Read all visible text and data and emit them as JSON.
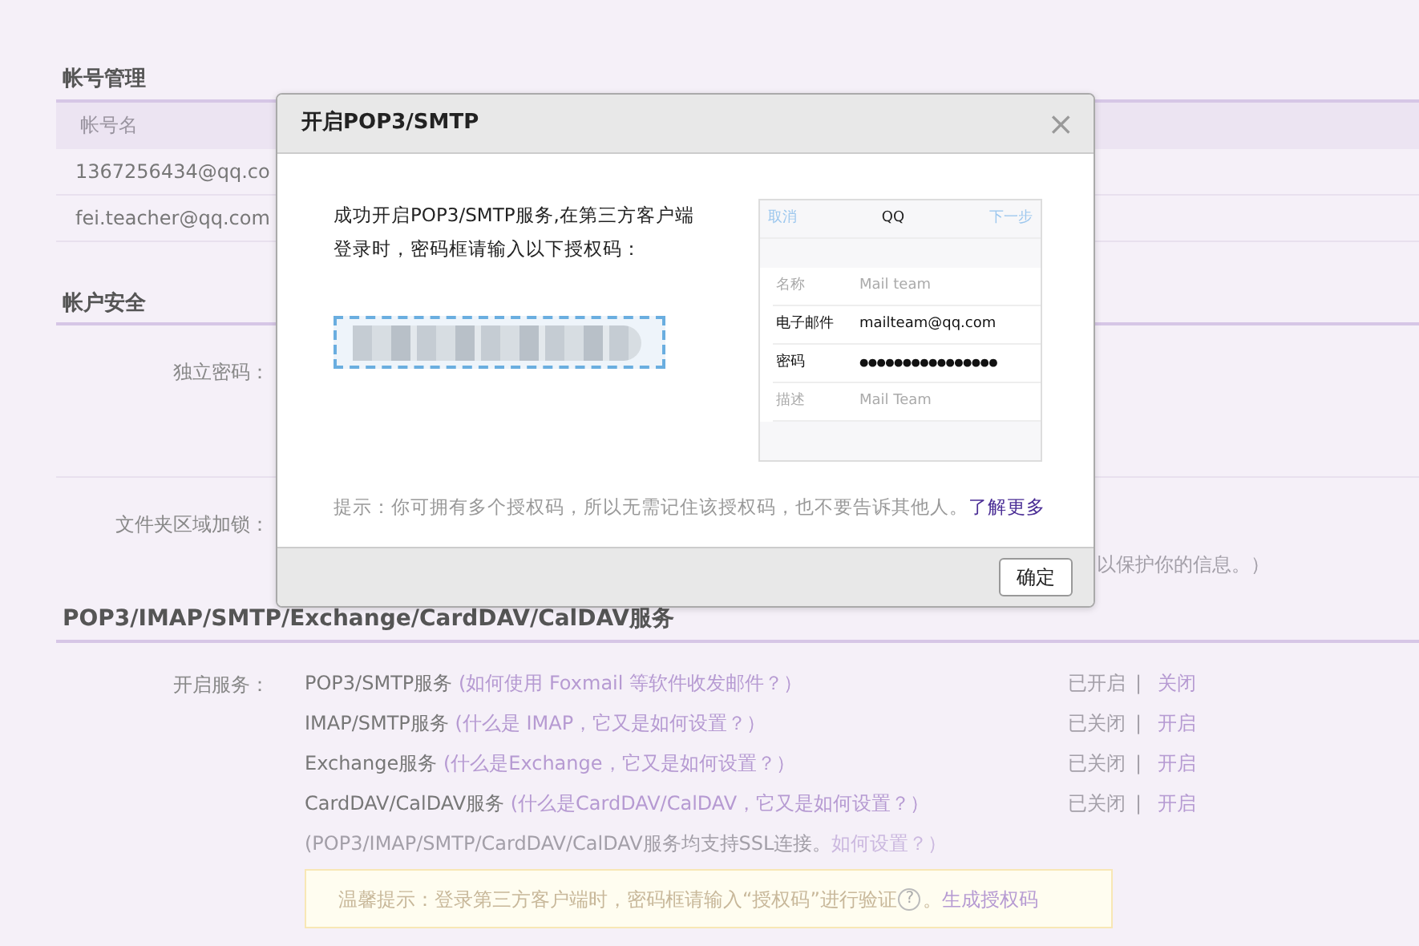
{
  "account_section": {
    "title": "帐号管理",
    "column_header": "帐号名",
    "accounts": [
      "1367256434@qq.co",
      "fei.teacher@qq.com"
    ]
  },
  "security_section": {
    "title": "帐户安全",
    "fields": [
      {
        "label": "独立密码："
      },
      {
        "label": "文件夹区域加锁：",
        "trailing_text": "以保护你的信息。）"
      }
    ]
  },
  "services_section": {
    "title": "POP3/IMAP/SMTP/Exchange/CardDAV/CalDAV服务",
    "label": "开启服务：",
    "services": [
      {
        "name": "POP3/SMTP服务",
        "help_link": "(如何使用 Foxmail 等软件收发邮件？）",
        "status": "已开启",
        "separator": "|",
        "action": "关闭"
      },
      {
        "name": "IMAP/SMTP服务",
        "help_link": "(什么是 IMAP，它又是如何设置？）",
        "status": "已关闭",
        "separator": "|",
        "action": "开启"
      },
      {
        "name": "Exchange服务",
        "help_link": "(什么是Exchange，它又是如何设置？）",
        "status": "已关闭",
        "separator": "|",
        "action": "开启"
      },
      {
        "name": "CardDAV/CalDAV服务",
        "help_link": "(什么是CardDAV/CalDAV，它又是如何设置？）",
        "status": "已关闭",
        "separator": "|",
        "action": "开启"
      }
    ],
    "ssl_note": "(POP3/IMAP/SMTP/CardDAV/CalDAV服务均支持SSL连接。",
    "ssl_link": "如何设置？）",
    "tip": {
      "text": "温馨提示：登录第三方客户端时，密码框请输入“授权码”进行验证",
      "help_glyph": "?",
      "text_after": "。",
      "link": "生成授权码"
    }
  },
  "dialog": {
    "title": "开启POP3/SMTP",
    "close": "×",
    "message": "成功开启POP3/SMTP服务,在第三方客户端登录时，密码框请输入以下授权码：",
    "phone_example": {
      "cancel": "取消",
      "title": "QQ",
      "next": "下一步",
      "rows": [
        {
          "label": "名称",
          "value": "Mail team",
          "emphasized": false
        },
        {
          "label": "电子邮件",
          "value": "mailteam@qq.com",
          "emphasized": true
        },
        {
          "label": "密码",
          "value": "●●●●●●●●●●●●●●●●",
          "emphasized": true
        },
        {
          "label": "描述",
          "value": "Mail Team",
          "emphasized": false
        }
      ]
    },
    "hint": "提示：你可拥有多个授权码，所以无需记住该授权码，也不要告诉其他人。",
    "hint_link": "了解更多",
    "ok_button": "确定"
  }
}
